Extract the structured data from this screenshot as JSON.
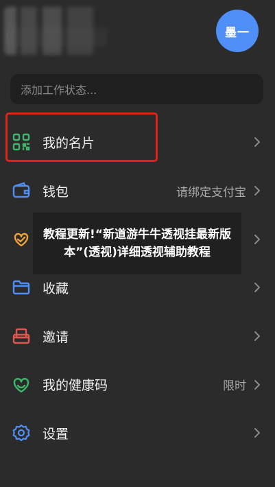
{
  "header": {
    "avatar_text": "墨一",
    "status_placeholder": "添加工作状态..."
  },
  "menu": {
    "items": [
      {
        "label": "我的名片",
        "value": "",
        "icon": "qr-code-icon",
        "color": "#3fb66b"
      },
      {
        "label": "钱包",
        "value": "请绑定支付宝",
        "icon": "wallet-icon",
        "color": "#4f8ff7"
      },
      {
        "label": "",
        "value": "",
        "icon": "heart-hand-icon",
        "color": "#f0a13a"
      },
      {
        "label": "收藏",
        "value": "",
        "icon": "folder-icon",
        "color": "#4f8ff7"
      },
      {
        "label": "邀请",
        "value": "",
        "icon": "invite-box-icon",
        "color": "#e0574f"
      },
      {
        "label": "我的健康码",
        "value": "限时",
        "icon": "health-heart-icon",
        "color": "#3fb66b"
      },
      {
        "label": "设置",
        "value": "",
        "icon": "gear-icon",
        "color": "#4f8ff7"
      }
    ]
  },
  "overlay": {
    "text": "教程更新!“新道游牛牛透视挂最新版本”(透视)详细透视辅助教程"
  },
  "colors": {
    "background": "#2b2b2b",
    "accent": "#4f8ff7",
    "highlight": "#e0241b"
  }
}
